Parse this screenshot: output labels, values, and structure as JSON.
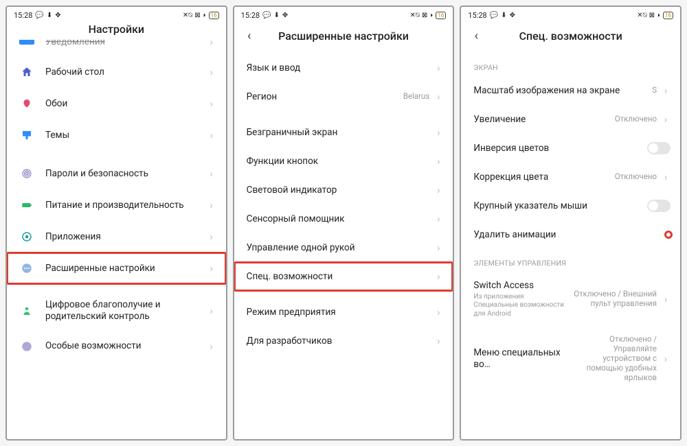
{
  "status": {
    "time": "15:28",
    "battery": "16"
  },
  "screen1": {
    "title": "Настройки",
    "rows": {
      "notifications": "Уведомления",
      "desktop": "Рабочий стол",
      "wallpaper": "Обои",
      "themes": "Темы",
      "passwords": "Пароли и безопасность",
      "power": "Питание и производительность",
      "apps": "Приложения",
      "advanced": "Расширенные настройки",
      "wellbeing": "Цифровое благополучие и родительский контроль",
      "special": "Особые возможности"
    }
  },
  "screen2": {
    "title": "Расширенные настройки",
    "rows": {
      "lang": "Язык и ввод",
      "region": "Регион",
      "region_val": "Belarus",
      "fullscreen": "Безграничный экран",
      "buttons": "Функции кнопок",
      "led": "Световой индикатор",
      "assist": "Сенсорный помощник",
      "onehand": "Управление одной рукой",
      "access": "Спец. возможности",
      "enterprise": "Режим предприятия",
      "dev": "Для разработчиков"
    }
  },
  "screen3": {
    "title": "Спец. возможности",
    "section_display": "ЭКРАН",
    "section_controls": "ЭЛЕМЕНТЫ УПРАВЛЕНИЯ",
    "rows": {
      "scale": "Масштаб изображения на экране",
      "scale_val": "S",
      "zoom": "Увеличение",
      "zoom_val": "Отключено",
      "invert": "Инверсия цветов",
      "colorcorr": "Коррекция цвета",
      "colorcorr_val": "Отключено",
      "bigpointer": "Крупный указатель мыши",
      "removeanim": "Удалить анимации",
      "switch_title": "Switch Access",
      "switch_sub": "Из приложения Специальные возможности для Android",
      "switch_val": "Отключено / Внешний пульт управления",
      "menu_title": "Меню специальных во…",
      "menu_val": "Отключено / Управляйте устройством с помощью удобных ярлыков"
    }
  }
}
